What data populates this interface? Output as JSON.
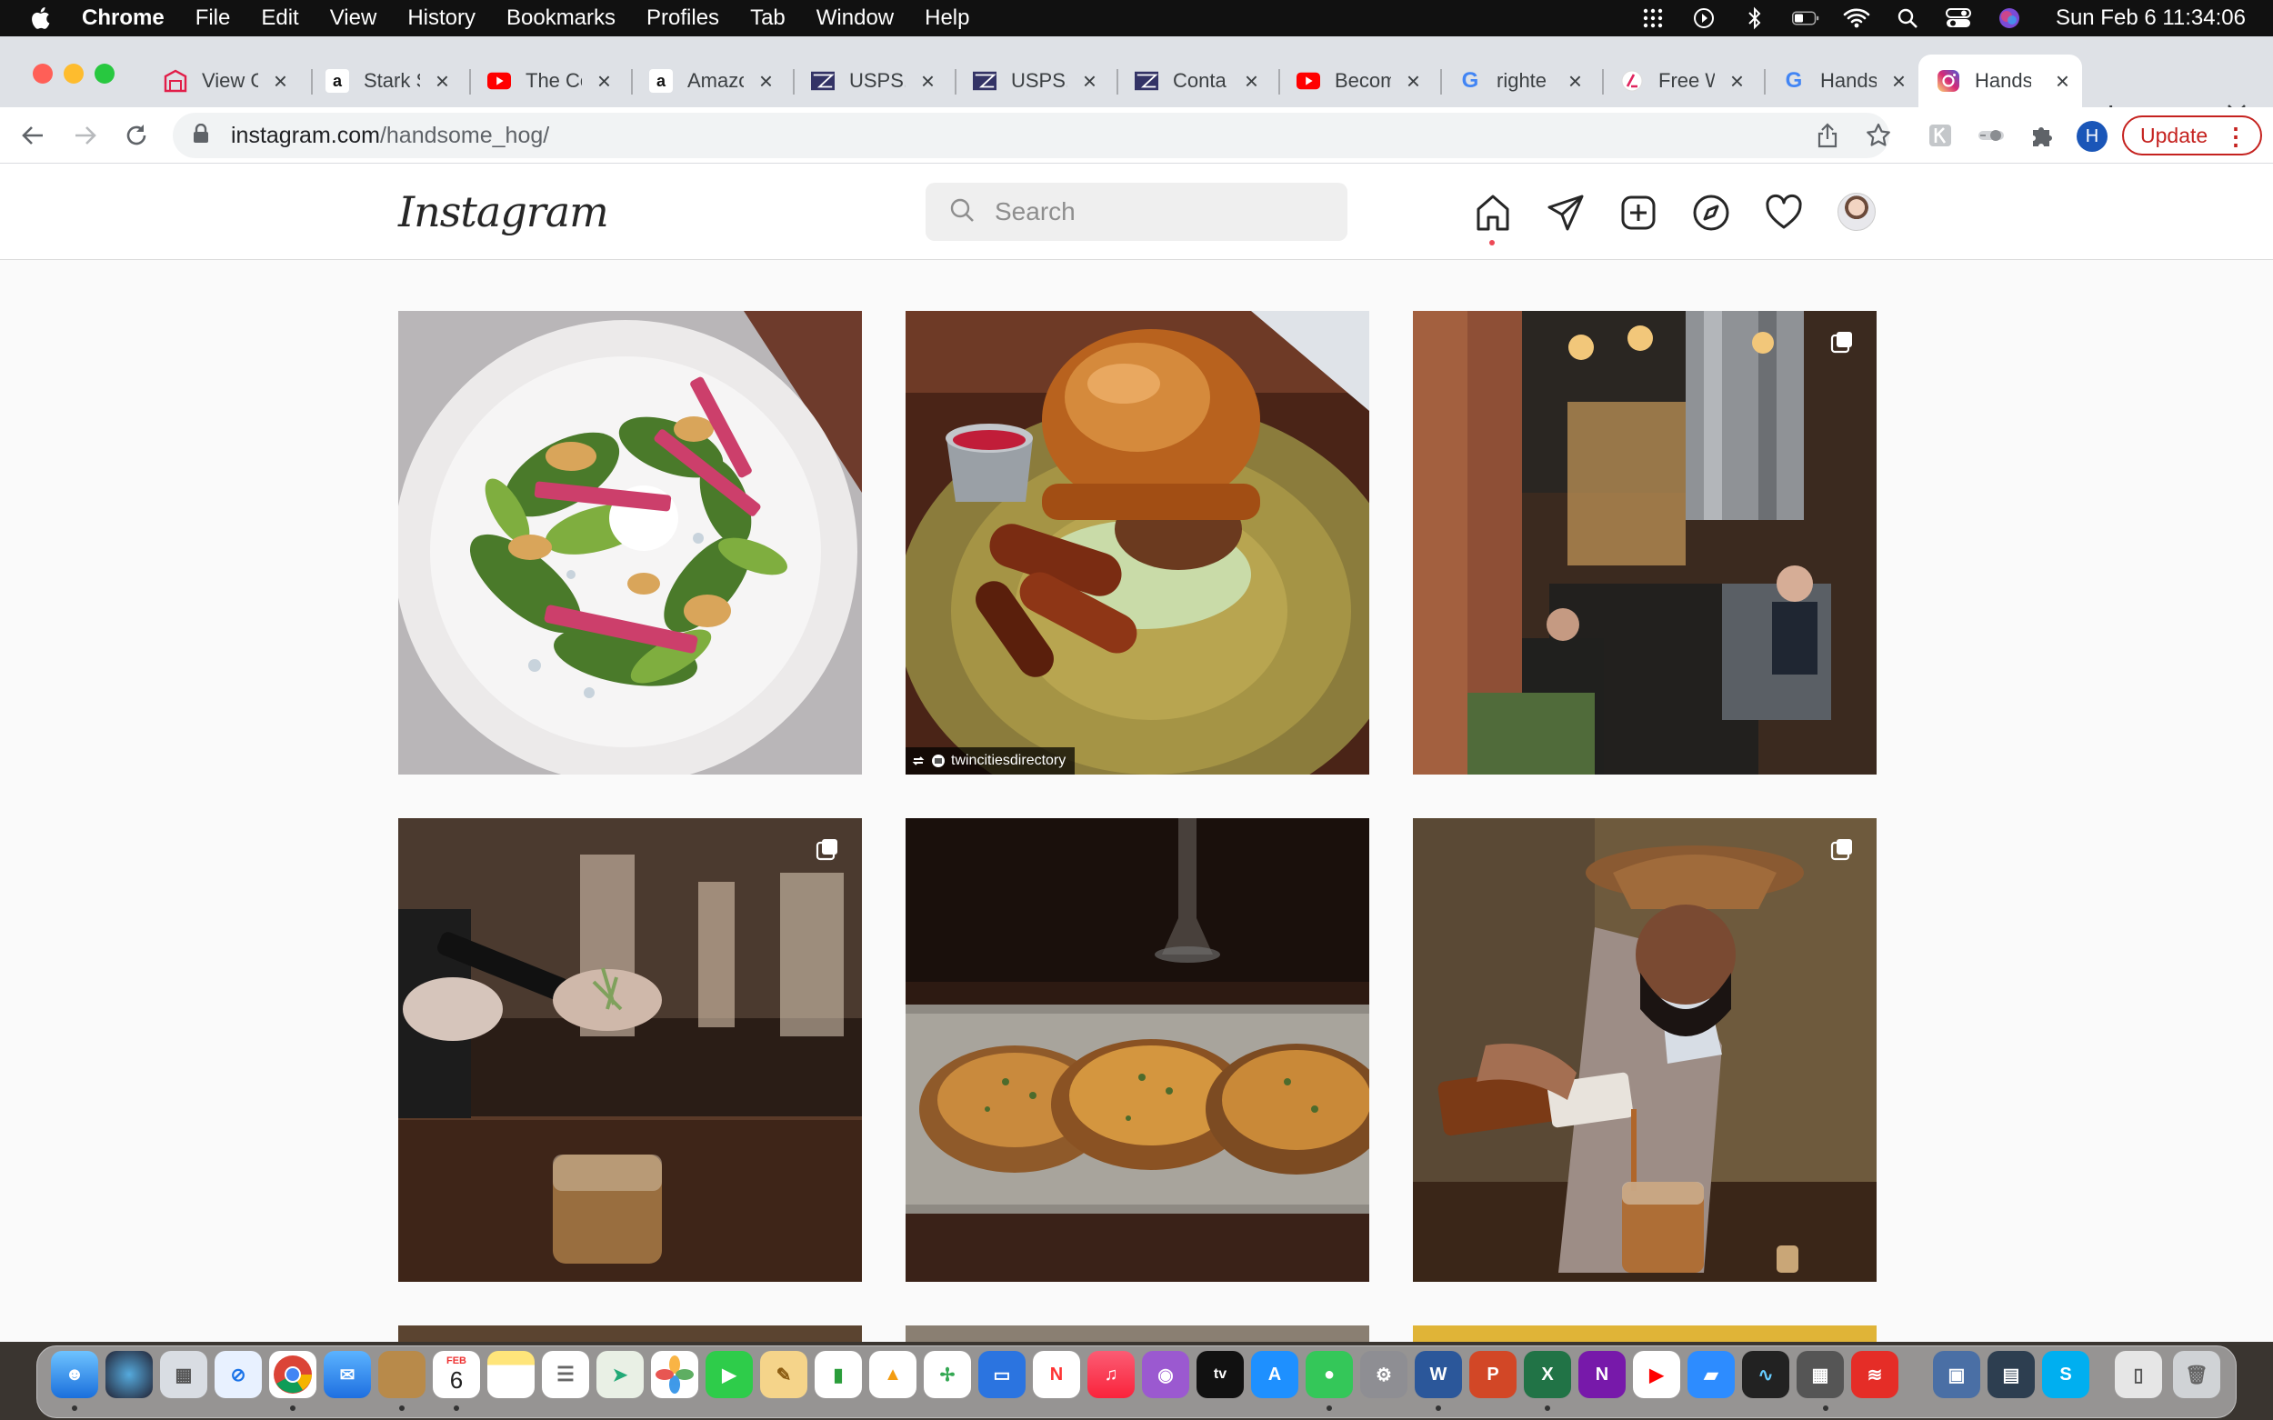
{
  "menubar": {
    "app_name": "Chrome",
    "menus": [
      "File",
      "Edit",
      "View",
      "History",
      "Bookmarks",
      "Profiles",
      "Tab",
      "Window",
      "Help"
    ],
    "clock": "Sun Feb 6  11:34:06"
  },
  "tabs": [
    {
      "title": "View C",
      "favicon": "gallery-icon",
      "color": "#e11d48"
    },
    {
      "title": "Stark S",
      "favicon": "amazon-icon",
      "color": "#111111"
    },
    {
      "title": "The Co",
      "favicon": "youtube-icon",
      "color": "#ff0000"
    },
    {
      "title": "Amazo",
      "favicon": "amazon-icon",
      "color": "#111111"
    },
    {
      "title": "USPS.",
      "favicon": "usps-icon",
      "color": "#333366"
    },
    {
      "title": "USPS.",
      "favicon": "usps-icon",
      "color": "#333366"
    },
    {
      "title": "Conta",
      "favicon": "usps-icon",
      "color": "#333366"
    },
    {
      "title": "Becom",
      "favicon": "youtube-icon",
      "color": "#ff0000"
    },
    {
      "title": "righte",
      "favicon": "google-icon",
      "color": "#4285f4"
    },
    {
      "title": "Free W",
      "favicon": "free-icon",
      "color": "#e0245e"
    },
    {
      "title": "Hands",
      "favicon": "google-icon",
      "color": "#4285f4"
    },
    {
      "title": "Hands",
      "favicon": "instagram-icon",
      "color": "#d6249f",
      "active": true
    }
  ],
  "address": {
    "host": "instagram.com",
    "path": "/handsome_hog/"
  },
  "toolbar": {
    "profile_initial": "H",
    "update_label": "Update"
  },
  "instagram": {
    "logo": "Instagram",
    "search_placeholder": "Search",
    "posts": [
      {
        "name": "post-salad",
        "multi": false,
        "credit": ""
      },
      {
        "name": "post-burger",
        "multi": false,
        "credit": "twincitiesdirectory"
      },
      {
        "name": "post-restaurant-interior",
        "multi": true,
        "credit": ""
      },
      {
        "name": "post-torch-garnish",
        "multi": true,
        "credit": ""
      },
      {
        "name": "post-oysters",
        "multi": false,
        "credit": ""
      },
      {
        "name": "post-whiskey-pour",
        "multi": true,
        "credit": ""
      }
    ]
  },
  "dock": {
    "calendar_day": "6",
    "calendar_month": "FEB"
  },
  "colors": {
    "update_red": "#c5221f",
    "notification_red": "#ed4956",
    "page_bg": "#fafafa"
  }
}
